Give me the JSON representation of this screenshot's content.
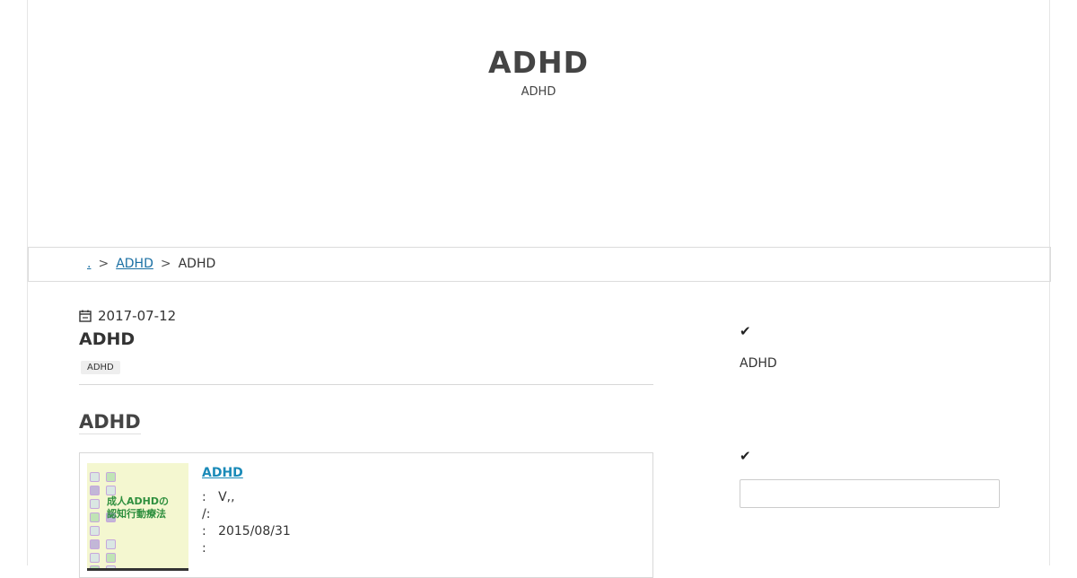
{
  "site": {
    "title": "ADHD",
    "description": "ADHD"
  },
  "breadcrumb": {
    "home_label": ".",
    "sep1": ">",
    "category_label": "ADHD",
    "sep2": ">",
    "current_label": "ADHD"
  },
  "article": {
    "date": "2017-07-12",
    "title": "ADHD",
    "tag": "ADHD",
    "section_heading": "ADHD",
    "book": {
      "link_label": "ADHD",
      "cover_title_line1": "成人ADHDの",
      "cover_title_line2": "認知行動療法",
      "meta": [
        ":   V,,",
        "/:",
        ":   2015/08/31",
        ":"
      ]
    }
  },
  "sidebar": {
    "widget1": {
      "icon": "check-icon",
      "text": "ADHD"
    },
    "widget2": {
      "icon": "check-icon",
      "search_placeholder": ""
    }
  },
  "colors": {
    "link": "#1a6fa3",
    "book_link": "#1a8ab8",
    "cover_bg": "#f4f7d0",
    "cover_green": "#2e8f3e"
  }
}
